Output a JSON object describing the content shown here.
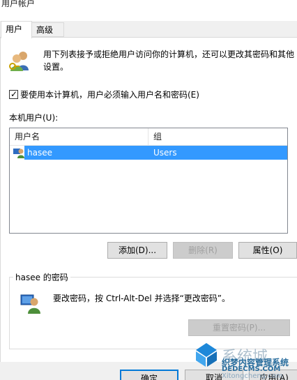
{
  "window": {
    "title": "用户帐户"
  },
  "tabs": [
    {
      "label": "用户",
      "active": true
    },
    {
      "label": "高级",
      "active": false
    }
  ],
  "intro": "用下列表接予或拒绝用户访问你的计算机，还可以更改其密码和其他设置。",
  "require_login": {
    "label": "要使用本计算机，用户必须输入用户名和密码(E)",
    "checked": true
  },
  "local_users": {
    "label": "本机用户(U):",
    "columns": [
      "用户名",
      "组"
    ],
    "rows": [
      {
        "name": "hasee",
        "group": "Users",
        "selected": true
      }
    ]
  },
  "buttons": {
    "add": "添加(D)...",
    "remove": "删除(R)",
    "properties": "属性(O)"
  },
  "password_group": {
    "title": "hasee 的密码",
    "text": "要改密码，按 Ctrl-Alt-Del 并选择“更改密码”。",
    "reset": "重置密码(P)..."
  },
  "footer": {
    "ok": "确定",
    "cancel": "取消",
    "apply": "应用(A)"
  },
  "watermark": {
    "brand": "系统城",
    "line2": "织梦内容管理系统",
    "line3": "DEDECMS.COM",
    "line4": "Xitongcheng.com"
  },
  "colors": {
    "selection": "#3399ff",
    "accent": "#0078d7"
  }
}
